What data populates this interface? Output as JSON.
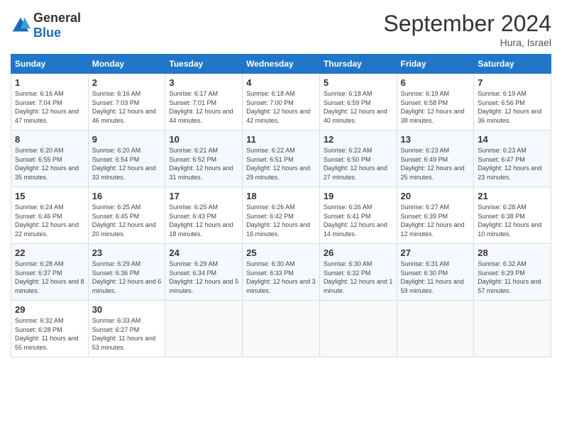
{
  "logo": {
    "general": "General",
    "blue": "Blue"
  },
  "title": "September 2024",
  "location": "Hura, Israel",
  "days_of_week": [
    "Sunday",
    "Monday",
    "Tuesday",
    "Wednesday",
    "Thursday",
    "Friday",
    "Saturday"
  ],
  "weeks": [
    [
      {
        "day": 1,
        "sunrise": "6:16 AM",
        "sunset": "7:04 PM",
        "daylight": "12 hours and 47 minutes."
      },
      {
        "day": 2,
        "sunrise": "6:16 AM",
        "sunset": "7:03 PM",
        "daylight": "12 hours and 46 minutes."
      },
      {
        "day": 3,
        "sunrise": "6:17 AM",
        "sunset": "7:01 PM",
        "daylight": "12 hours and 44 minutes."
      },
      {
        "day": 4,
        "sunrise": "6:18 AM",
        "sunset": "7:00 PM",
        "daylight": "12 hours and 42 minutes."
      },
      {
        "day": 5,
        "sunrise": "6:18 AM",
        "sunset": "6:59 PM",
        "daylight": "12 hours and 40 minutes."
      },
      {
        "day": 6,
        "sunrise": "6:19 AM",
        "sunset": "6:58 PM",
        "daylight": "12 hours and 38 minutes."
      },
      {
        "day": 7,
        "sunrise": "6:19 AM",
        "sunset": "6:56 PM",
        "daylight": "12 hours and 36 minutes."
      }
    ],
    [
      {
        "day": 8,
        "sunrise": "6:20 AM",
        "sunset": "6:55 PM",
        "daylight": "12 hours and 35 minutes."
      },
      {
        "day": 9,
        "sunrise": "6:20 AM",
        "sunset": "6:54 PM",
        "daylight": "12 hours and 33 minutes."
      },
      {
        "day": 10,
        "sunrise": "6:21 AM",
        "sunset": "6:52 PM",
        "daylight": "12 hours and 31 minutes."
      },
      {
        "day": 11,
        "sunrise": "6:22 AM",
        "sunset": "6:51 PM",
        "daylight": "12 hours and 29 minutes."
      },
      {
        "day": 12,
        "sunrise": "6:22 AM",
        "sunset": "6:50 PM",
        "daylight": "12 hours and 27 minutes."
      },
      {
        "day": 13,
        "sunrise": "6:23 AM",
        "sunset": "6:49 PM",
        "daylight": "12 hours and 25 minutes."
      },
      {
        "day": 14,
        "sunrise": "6:23 AM",
        "sunset": "6:47 PM",
        "daylight": "12 hours and 23 minutes."
      }
    ],
    [
      {
        "day": 15,
        "sunrise": "6:24 AM",
        "sunset": "6:46 PM",
        "daylight": "12 hours and 22 minutes."
      },
      {
        "day": 16,
        "sunrise": "6:25 AM",
        "sunset": "6:45 PM",
        "daylight": "12 hours and 20 minutes."
      },
      {
        "day": 17,
        "sunrise": "6:25 AM",
        "sunset": "6:43 PM",
        "daylight": "12 hours and 18 minutes."
      },
      {
        "day": 18,
        "sunrise": "6:26 AM",
        "sunset": "6:42 PM",
        "daylight": "12 hours and 16 minutes."
      },
      {
        "day": 19,
        "sunrise": "6:26 AM",
        "sunset": "6:41 PM",
        "daylight": "12 hours and 14 minutes."
      },
      {
        "day": 20,
        "sunrise": "6:27 AM",
        "sunset": "6:39 PM",
        "daylight": "12 hours and 12 minutes."
      },
      {
        "day": 21,
        "sunrise": "6:28 AM",
        "sunset": "6:38 PM",
        "daylight": "12 hours and 10 minutes."
      }
    ],
    [
      {
        "day": 22,
        "sunrise": "6:28 AM",
        "sunset": "6:37 PM",
        "daylight": "12 hours and 8 minutes."
      },
      {
        "day": 23,
        "sunrise": "6:29 AM",
        "sunset": "6:36 PM",
        "daylight": "12 hours and 6 minutes."
      },
      {
        "day": 24,
        "sunrise": "6:29 AM",
        "sunset": "6:34 PM",
        "daylight": "12 hours and 5 minutes."
      },
      {
        "day": 25,
        "sunrise": "6:30 AM",
        "sunset": "6:33 PM",
        "daylight": "12 hours and 3 minutes."
      },
      {
        "day": 26,
        "sunrise": "6:30 AM",
        "sunset": "6:32 PM",
        "daylight": "12 hours and 1 minute."
      },
      {
        "day": 27,
        "sunrise": "6:31 AM",
        "sunset": "6:30 PM",
        "daylight": "11 hours and 59 minutes."
      },
      {
        "day": 28,
        "sunrise": "6:32 AM",
        "sunset": "6:29 PM",
        "daylight": "11 hours and 57 minutes."
      }
    ],
    [
      {
        "day": 29,
        "sunrise": "6:32 AM",
        "sunset": "6:28 PM",
        "daylight": "11 hours and 55 minutes."
      },
      {
        "day": 30,
        "sunrise": "6:33 AM",
        "sunset": "6:27 PM",
        "daylight": "11 hours and 53 minutes."
      },
      null,
      null,
      null,
      null,
      null
    ]
  ]
}
